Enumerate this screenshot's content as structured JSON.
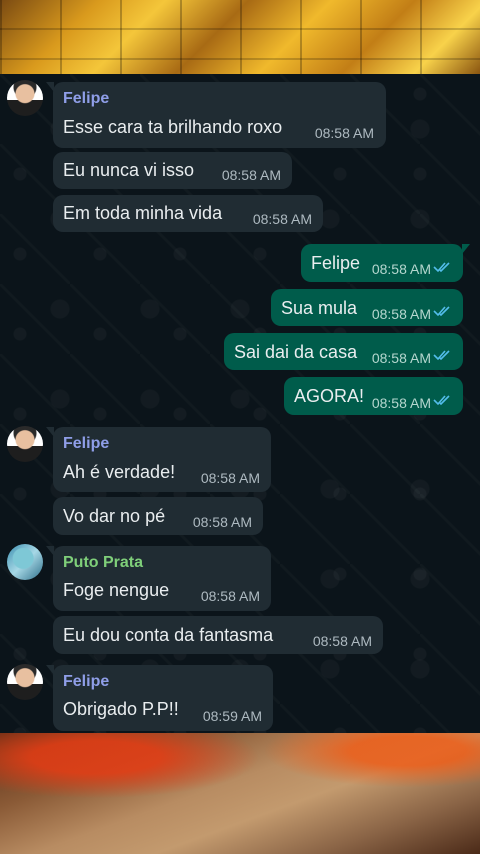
{
  "messages": [
    {
      "dir": "in",
      "sender": "Felipe",
      "text": "Esse cara ta brilhando roxo",
      "time": "08:58 AM"
    },
    {
      "dir": "in",
      "text": "Eu nunca vi isso",
      "time": "08:58 AM"
    },
    {
      "dir": "in",
      "text": "Em toda minha vida",
      "time": "08:58 AM"
    },
    {
      "dir": "out",
      "text": "Felipe",
      "time": "08:58 AM",
      "status": "read"
    },
    {
      "dir": "out",
      "text": "Sua mula",
      "time": "08:58 AM",
      "status": "read"
    },
    {
      "dir": "out",
      "text": "Sai dai da casa",
      "time": "08:58 AM",
      "status": "read"
    },
    {
      "dir": "out",
      "text": "AGORA!",
      "time": "08:58 AM",
      "status": "read"
    },
    {
      "dir": "in",
      "sender": "Felipe",
      "text": "Ah é verdade!",
      "time": "08:58 AM"
    },
    {
      "dir": "in",
      "text": "Vo dar no pé",
      "time": "08:58 AM"
    },
    {
      "dir": "in",
      "sender": "Puto Prata",
      "text": "Foge nengue",
      "time": "08:58 AM"
    },
    {
      "dir": "in",
      "text": "Eu dou conta da fantasma",
      "time": "08:58 AM"
    },
    {
      "dir": "in",
      "sender": "Felipe",
      "text": "Obrigado P.P!!",
      "time": "08:59 AM"
    }
  ],
  "colors": {
    "incoming_bubble": "#202c33",
    "outgoing_bubble": "#005c4b",
    "read_ticks": "#53bdeb",
    "sender_felipe": "#8f9ee8",
    "sender_puto_prata": "#7fcf7a"
  }
}
